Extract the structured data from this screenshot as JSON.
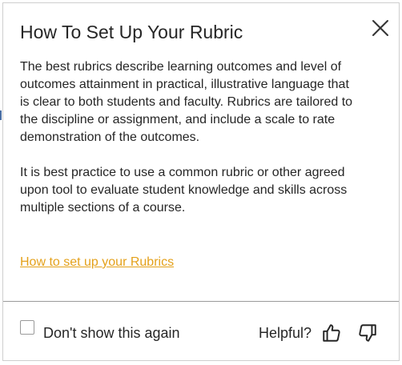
{
  "dialog": {
    "title": "How To Set Up Your Rubric",
    "close_icon": "close-icon",
    "paragraphs": [
      "The best rubrics describe learning outcomes and level of outcomes attainment in practical, illustrative language that is clear to both students and faculty. Rubrics are tailored to the discipline or assignment, and include a scale to rate demonstration of the outcomes.",
      "It is best practice to use a common rubric or other agreed upon tool to evaluate student knowledge and skills across multiple sections of a course."
    ],
    "link_text": "How to set up your Rubrics",
    "link_color": "#e4a11b"
  },
  "footer": {
    "checkbox_label": "Don't show this again",
    "checkbox_checked": false,
    "helpful_label": "Helpful?",
    "thumbs_up_icon": "thumbs-up-icon",
    "thumbs_down_icon": "thumbs-down-icon"
  }
}
